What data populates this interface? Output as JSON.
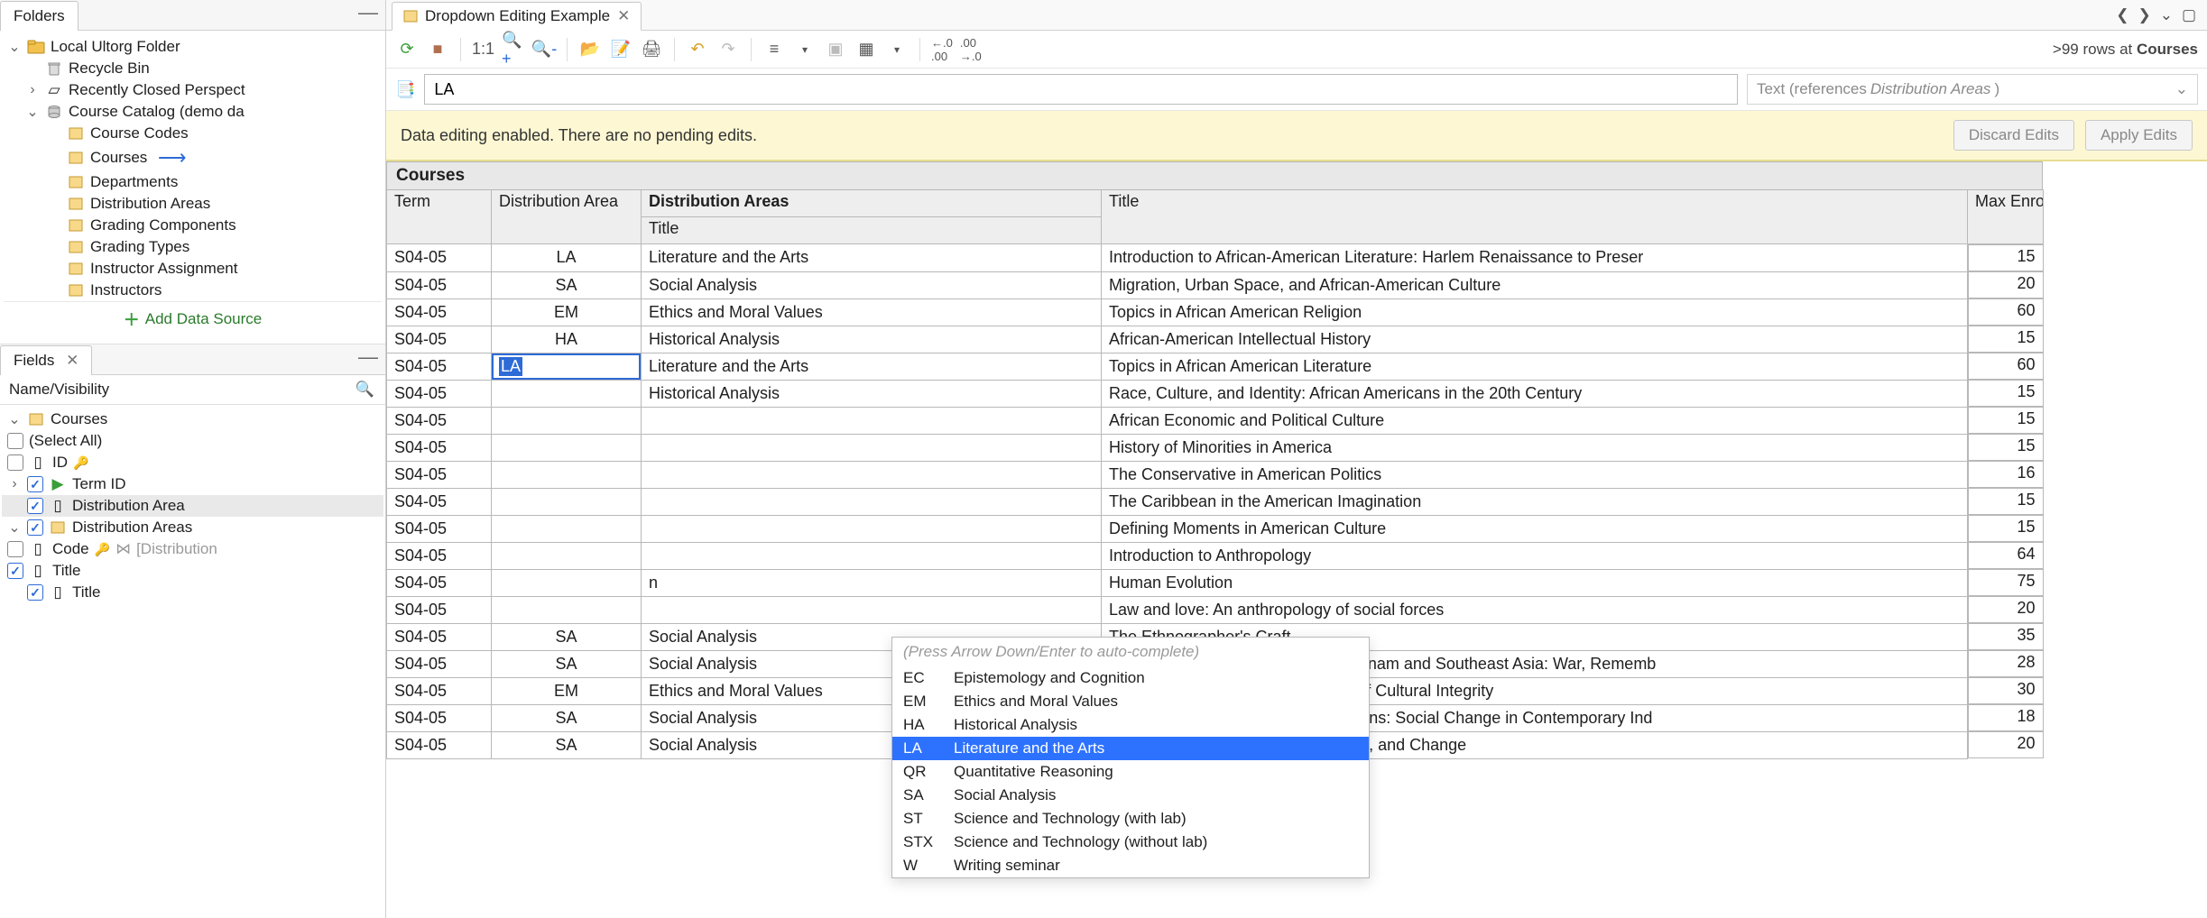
{
  "left": {
    "folders_tab": "Folders",
    "tree": {
      "root": "Local Ultorg Folder",
      "recycle": "Recycle Bin",
      "recent": "Recently Closed Perspect",
      "catalog": "Course Catalog (demo da",
      "children": [
        "Course Codes",
        "Courses",
        "Departments",
        "Distribution Areas",
        "Grading Components",
        "Grading Types",
        "Instructor Assignment",
        "Instructors"
      ],
      "add_ds": "Add Data Source"
    },
    "fields_tab": "Fields",
    "fields_header": "Name/Visibility",
    "fields": {
      "root": "Courses",
      "select_all": "(Select All)",
      "id": "ID",
      "term": "Term ID",
      "da": "Distribution Area",
      "das": "Distribution Areas",
      "code": "Code",
      "code_note": "[Distribution",
      "title": "Title",
      "title2": "Title"
    }
  },
  "editor": {
    "tab_title": "Dropdown Editing Example",
    "rowcount_prefix": ">99 rows at ",
    "rowcount_table": "Courses",
    "toolbar_ratio": "1:1",
    "search_value": "LA",
    "type_hint_1": "Text (references ",
    "type_hint_2": "Distribution Areas",
    "type_hint_3": ")",
    "yellow_msg": "Data editing enabled. There are no pending edits.",
    "discard": "Discard Edits",
    "apply": "Apply Edits"
  },
  "grid": {
    "title": "Courses",
    "headers": {
      "term": "Term",
      "da": "Distribution Area",
      "dat_group": "Distribution Areas",
      "dat_sub": "Title",
      "title": "Title",
      "enroll": "Max Enroll"
    },
    "rows": [
      {
        "term": "S04-05",
        "da": "LA",
        "dat": "Literature and the Arts",
        "title": "Introduction to African-American Literature: Harlem Renaissance to Preser",
        "enroll": 15
      },
      {
        "term": "S04-05",
        "da": "SA",
        "dat": "Social Analysis",
        "title": "Migration, Urban Space, and African-American Culture",
        "enroll": 20
      },
      {
        "term": "S04-05",
        "da": "EM",
        "dat": "Ethics and Moral Values",
        "title": "Topics in African American Religion",
        "enroll": 60
      },
      {
        "term": "S04-05",
        "da": "HA",
        "dat": "Historical Analysis",
        "title": "African-American Intellectual History",
        "enroll": 15
      },
      {
        "term": "S04-05",
        "da": "LA",
        "dat": "Literature and the Arts",
        "title": "Topics in African American Literature",
        "enroll": 60,
        "editing": true
      },
      {
        "term": "S04-05",
        "da": "",
        "dat": "Historical Analysis",
        "title": "Race, Culture, and Identity: African Americans in the 20th Century",
        "enroll": 15
      },
      {
        "term": "S04-05",
        "da": "",
        "dat": "",
        "title": "African Economic and Political Culture",
        "enroll": 15
      },
      {
        "term": "S04-05",
        "da": "",
        "dat": "",
        "title": "History of Minorities in America",
        "enroll": 15
      },
      {
        "term": "S04-05",
        "da": "",
        "dat": "",
        "title": "The Conservative in American Politics",
        "enroll": 16
      },
      {
        "term": "S04-05",
        "da": "",
        "dat": "",
        "title": "The Caribbean in the American Imagination",
        "enroll": 15
      },
      {
        "term": "S04-05",
        "da": "",
        "dat": "",
        "title": "Defining Moments in American Culture",
        "enroll": 15
      },
      {
        "term": "S04-05",
        "da": "",
        "dat": "",
        "title": "Introduction to Anthropology",
        "enroll": 64
      },
      {
        "term": "S04-05",
        "da": "",
        "dat": "n",
        "title": "Human Evolution",
        "enroll": 75
      },
      {
        "term": "S04-05",
        "da": "",
        "dat": "",
        "title": "Law and love: An anthropology of social forces",
        "enroll": 20
      },
      {
        "term": "S04-05",
        "da": "SA",
        "dat": "Social Analysis",
        "title": "The Ethnographer's Craft",
        "enroll": 35
      },
      {
        "term": "S04-05",
        "da": "SA",
        "dat": "Social Analysis",
        "title": "Current Issues in Anthropology: Vietnam and Southeast Asia: War, Rememb",
        "enroll": 28
      },
      {
        "term": "S04-05",
        "da": "EM",
        "dat": "Ethics and Moral Values",
        "title": "Indigenous Peoples and the Right of Cultural Integrity",
        "enroll": 30
      },
      {
        "term": "S04-05",
        "da": "SA",
        "dat": "Social Analysis",
        "title": "The Anthropology of Selected Regions: Social Change in Contemporary Ind",
        "enroll": 18
      },
      {
        "term": "S04-05",
        "da": "SA",
        "dat": "Social Analysis",
        "title": "Pacific Islanders: Histories, Cultures, and Change",
        "enroll": 20
      }
    ]
  },
  "autocomplete": {
    "hint": "(Press Arrow Down/Enter to auto-complete)",
    "selected_index": 3,
    "options": [
      {
        "code": "EC",
        "name": "Epistemology and Cognition"
      },
      {
        "code": "EM",
        "name": "Ethics and Moral Values"
      },
      {
        "code": "HA",
        "name": "Historical Analysis"
      },
      {
        "code": "LA",
        "name": "Literature and the Arts"
      },
      {
        "code": "QR",
        "name": "Quantitative Reasoning"
      },
      {
        "code": "SA",
        "name": "Social Analysis"
      },
      {
        "code": "ST",
        "name": "Science and Technology (with lab)"
      },
      {
        "code": "STX",
        "name": "Science and Technology (without lab)"
      },
      {
        "code": "W",
        "name": "Writing seminar"
      }
    ]
  },
  "chart_data": {
    "type": "table",
    "title": "Courses",
    "columns": [
      "Term",
      "Distribution Area",
      "Distribution Areas Title",
      "Title",
      "Max Enroll"
    ],
    "rows": [
      [
        "S04-05",
        "LA",
        "Literature and the Arts",
        "Introduction to African-American Literature: Harlem Renaissance to Preser",
        15
      ],
      [
        "S04-05",
        "SA",
        "Social Analysis",
        "Migration, Urban Space, and African-American Culture",
        20
      ],
      [
        "S04-05",
        "EM",
        "Ethics and Moral Values",
        "Topics in African American Religion",
        60
      ],
      [
        "S04-05",
        "HA",
        "Historical Analysis",
        "African-American Intellectual History",
        15
      ],
      [
        "S04-05",
        "LA",
        "Literature and the Arts",
        "Topics in African American Literature",
        60
      ],
      [
        "S04-05",
        "",
        "Historical Analysis",
        "Race, Culture, and Identity: African Americans in the 20th Century",
        15
      ],
      [
        "S04-05",
        "",
        "",
        "African Economic and Political Culture",
        15
      ],
      [
        "S04-05",
        "",
        "",
        "History of Minorities in America",
        15
      ],
      [
        "S04-05",
        "",
        "",
        "The Conservative in American Politics",
        16
      ],
      [
        "S04-05",
        "",
        "",
        "The Caribbean in the American Imagination",
        15
      ],
      [
        "S04-05",
        "",
        "",
        "Defining Moments in American Culture",
        15
      ],
      [
        "S04-05",
        "",
        "",
        "Introduction to Anthropology",
        64
      ],
      [
        "S04-05",
        "",
        "n",
        "Human Evolution",
        75
      ],
      [
        "S04-05",
        "",
        "",
        "Law and love: An anthropology of social forces",
        20
      ],
      [
        "S04-05",
        "SA",
        "Social Analysis",
        "The Ethnographer's Craft",
        35
      ],
      [
        "S04-05",
        "SA",
        "Social Analysis",
        "Current Issues in Anthropology: Vietnam and Southeast Asia: War, Rememb",
        28
      ],
      [
        "S04-05",
        "EM",
        "Ethics and Moral Values",
        "Indigenous Peoples and the Right of Cultural Integrity",
        30
      ],
      [
        "S04-05",
        "SA",
        "Social Analysis",
        "The Anthropology of Selected Regions: Social Change in Contemporary Ind",
        18
      ],
      [
        "S04-05",
        "SA",
        "Social Analysis",
        "Pacific Islanders: Histories, Cultures, and Change",
        20
      ]
    ]
  }
}
